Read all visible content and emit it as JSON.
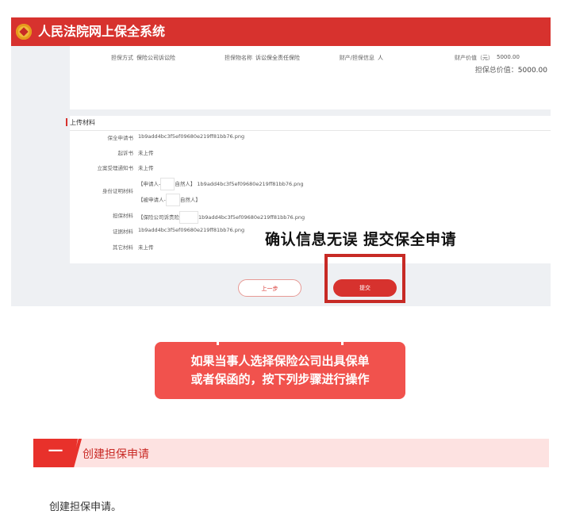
{
  "app": {
    "title": "人民法院网上保全系统"
  },
  "guarantee_info": {
    "method_label": "担保方式",
    "method_value": "保险公司诉讼险",
    "name_label": "担保物名称",
    "name_value": "诉讼保全责任保险",
    "property_label": "财产/担保信息",
    "property_value": "人",
    "value_label": "财产价值（元）",
    "value_value": "5000.00",
    "total_label": "担保总价值：",
    "total_value": "5000.00"
  },
  "upload": {
    "section_title": "上传材料",
    "rows": [
      {
        "label": "保全申请书",
        "value": "1b9add4bc3f5ef09680e219ff81bb76.png"
      },
      {
        "label": "起诉书",
        "value": "未上传"
      },
      {
        "label": "立案受理通知书",
        "value": "未上传"
      },
      {
        "label": "身份证明材料",
        "value_1a": "【申请人-",
        "value_1b": "自然人】 1b9add4bc3f5ef09680e219ff81bb76.png",
        "value_2a": "【被申请人-",
        "value_2b": "自然人】"
      },
      {
        "label": "担保材料",
        "value_a": "【保险公司诉责险",
        "value_b": "1b9add4bc3f5ef09680e219ff81bb76.png"
      },
      {
        "label": "证据材料",
        "value": "1b9add4bc3f5ef09680e219ff81bb76.png"
      },
      {
        "label": "其它材料",
        "value": "未上传"
      }
    ]
  },
  "buttons": {
    "prev": "上一步",
    "submit": "提交"
  },
  "annotation": "确认信息无误 提交保全申请",
  "callout": {
    "line1": "如果当事人选择保险公司出具保单",
    "line2": "或者保函的，按下列步骤进行操作"
  },
  "step": {
    "number": "一",
    "title": "创建担保申请"
  },
  "body_text": "创建担保申请。",
  "colors": {
    "brand_red": "#d7322e",
    "callout": "#f1524d",
    "step_bg": "#fde2e1"
  }
}
